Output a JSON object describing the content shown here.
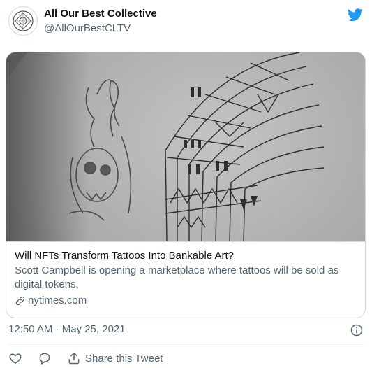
{
  "author": {
    "name": "All Our Best Collective",
    "handle": "@AllOurBestCLTV"
  },
  "card": {
    "title": "Will NFTs Transform Tattoos Into Bankable Art?",
    "description": "Scott Campbell is opening a marketplace where tattoos will be sold as digital tokens.",
    "domain": "nytimes.com"
  },
  "tweet": {
    "timestamp": "12:50 AM · May 25, 2021"
  },
  "actions": {
    "share_label": "Share this Tweet"
  },
  "colors": {
    "twitter_blue": "#1d9bf0",
    "secondary_text": "#536471",
    "border": "#cfd9de"
  },
  "icons": [
    "twitter-bird-icon",
    "info-icon",
    "like-icon",
    "reply-icon",
    "share-icon",
    "link-icon"
  ]
}
